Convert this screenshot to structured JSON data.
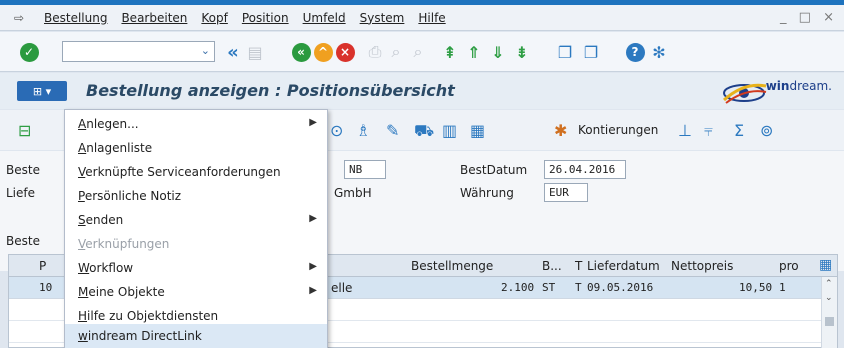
{
  "menubar": {
    "items": [
      "Bestellung",
      "Bearbeiten",
      "Kopf",
      "Position",
      "Umfeld",
      "System",
      "Hilfe"
    ],
    "window_controls": "_ □ ×"
  },
  "toolbar": {
    "command_value": ""
  },
  "title": {
    "text": "Bestellung anzeigen : Positionsübersicht"
  },
  "logo": {
    "bold": "win",
    "rest": "dream."
  },
  "apptoolbar": {
    "kontierungen": "Kontierungen"
  },
  "header": {
    "label_bestellart": "Beste",
    "label_lieferant": "Liefe",
    "bestellart_value": "NB",
    "lieferant_suffix": "GmbH",
    "label_bestdatum": "BestDatum",
    "bestdatum_value": "26.04.2016",
    "label_waehrung": "Währung",
    "waehrung_value": "EUR",
    "section_label": "Beste"
  },
  "grid": {
    "headers": [
      "P",
      "Bestellmenge",
      "B...",
      "T",
      "Lieferdatum",
      "Nettopreis",
      "pro"
    ],
    "row": {
      "pos": "10",
      "text": "elle",
      "menge": "2.100",
      "einheit": "ST",
      "typ": "T",
      "lieferdatum": "09.05.2016",
      "preis": "10,50",
      "pro": "1"
    }
  },
  "context_menu": {
    "items": [
      {
        "label": "Anlegen...",
        "submenu": true,
        "disabled": false
      },
      {
        "label": "Anlagenliste",
        "submenu": false,
        "disabled": false
      },
      {
        "label": "Verknüpfte Serviceanforderungen",
        "submenu": false,
        "disabled": false
      },
      {
        "label": "Persönliche Notiz",
        "submenu": false,
        "disabled": false
      },
      {
        "label": "Senden",
        "submenu": true,
        "disabled": false
      },
      {
        "label": "Verknüpfungen",
        "submenu": false,
        "disabled": true
      },
      {
        "label": "Workflow",
        "submenu": true,
        "disabled": false
      },
      {
        "label": "Meine Objekte",
        "submenu": true,
        "disabled": false
      },
      {
        "label": "Hilfe zu Objektdiensten",
        "submenu": false,
        "disabled": false
      },
      {
        "label": "windream DirectLink",
        "submenu": false,
        "disabled": false
      }
    ]
  }
}
